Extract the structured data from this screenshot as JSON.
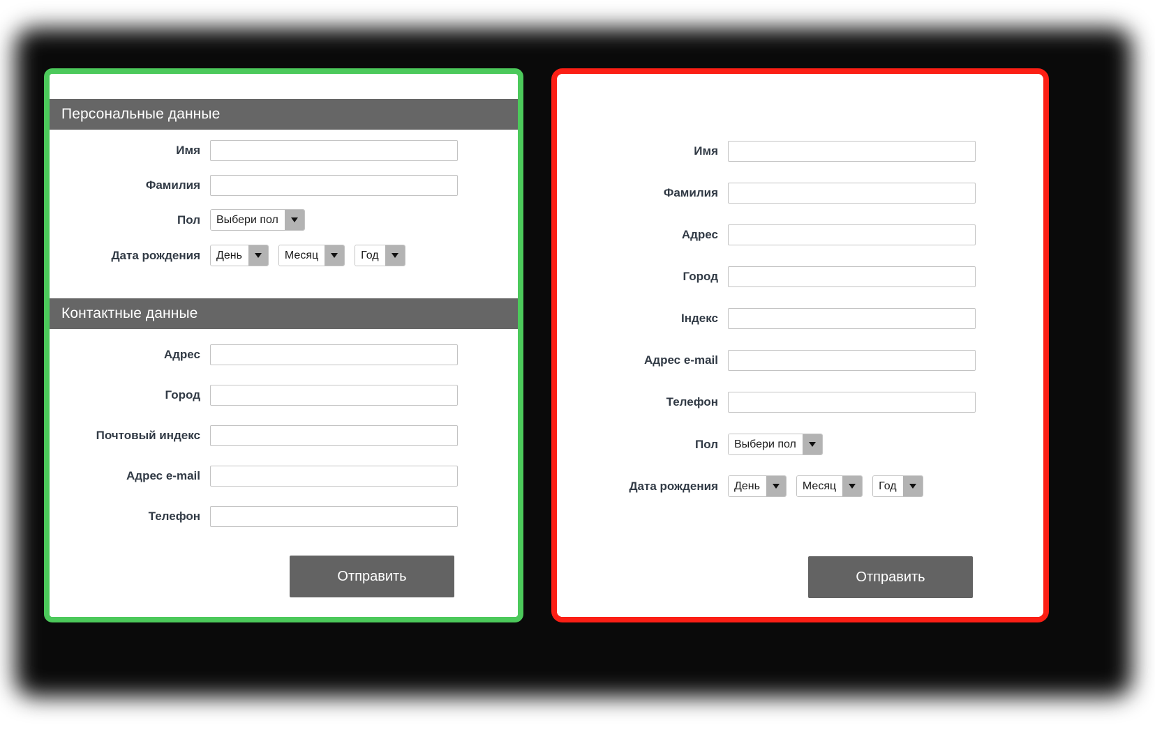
{
  "colors": {
    "valid_border": "#4cc95b",
    "invalid_border": "#fb1f15",
    "section_bar": "#666666",
    "button": "#636363",
    "label_text": "#313a45",
    "select_arrow": "#b3b3b3"
  },
  "left_form": {
    "sections": [
      {
        "title": "Персональные данные",
        "fields": [
          {
            "label": "Имя",
            "type": "text",
            "value": "",
            "placeholder": ""
          },
          {
            "label": "Фамилия",
            "type": "text",
            "value": "",
            "placeholder": ""
          },
          {
            "label": "Пол",
            "type": "select",
            "selected": "Выбери пол"
          },
          {
            "label": "Дата рождения",
            "type": "date-group",
            "selects": [
              {
                "selected": "День"
              },
              {
                "selected": "Месяц"
              },
              {
                "selected": "Год"
              }
            ]
          }
        ]
      },
      {
        "title": "Контактные данные",
        "fields": [
          {
            "label": "Адрес",
            "type": "text",
            "value": "",
            "placeholder": ""
          },
          {
            "label": "Город",
            "type": "text",
            "value": "",
            "placeholder": ""
          },
          {
            "label": "Почтовый индекс",
            "type": "text",
            "value": "",
            "placeholder": ""
          },
          {
            "label": "Адрес e-mail",
            "type": "text",
            "value": "",
            "placeholder": ""
          },
          {
            "label": "Телефон",
            "type": "text",
            "value": "",
            "placeholder": ""
          }
        ]
      }
    ],
    "submit_label": "Отправить"
  },
  "right_form": {
    "fields": [
      {
        "label": "Имя",
        "type": "text",
        "value": "",
        "placeholder": ""
      },
      {
        "label": "Фамилия",
        "type": "text",
        "value": "",
        "placeholder": ""
      },
      {
        "label": "Адрес",
        "type": "text",
        "value": "",
        "placeholder": ""
      },
      {
        "label": "Город",
        "type": "text",
        "value": "",
        "placeholder": ""
      },
      {
        "label": "Індекс",
        "type": "text",
        "value": "",
        "placeholder": ""
      },
      {
        "label": "Адрес e-mail",
        "type": "text",
        "value": "",
        "placeholder": ""
      },
      {
        "label": "Телефон",
        "type": "text",
        "value": "",
        "placeholder": ""
      },
      {
        "label": "Пол",
        "type": "select",
        "selected": "Выбери пол"
      },
      {
        "label": "Дата рождения",
        "type": "date-group",
        "selects": [
          {
            "selected": "День"
          },
          {
            "selected": "Месяц"
          },
          {
            "selected": "Год"
          }
        ]
      }
    ],
    "submit_label": "Отправить"
  }
}
